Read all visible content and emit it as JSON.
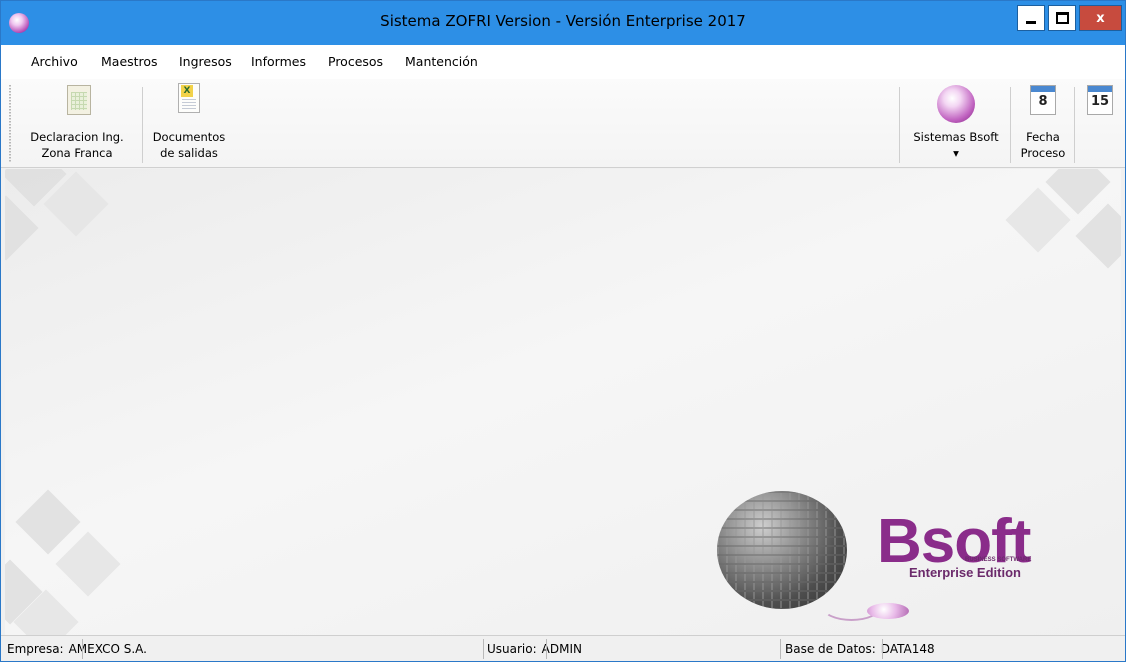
{
  "window": {
    "title": "Sistema ZOFRI Version  - Versión Enterprise 2017",
    "close_label": "x"
  },
  "menu": [
    "Archivo",
    "Maestros",
    "Ingresos",
    "Informes",
    "Procesos",
    "Mantención"
  ],
  "toolbar": {
    "declaracion": {
      "line1": "Declaracion Ing.",
      "line2": "Zona Franca"
    },
    "documentos": {
      "line1": "Documentos",
      "line2": "de salidas"
    },
    "sistemas": {
      "label": "Sistemas Bsoft",
      "arrow": "▾"
    },
    "fecha": {
      "line1": "Fecha",
      "line2": "Proceso"
    },
    "calendar_day_1": "8",
    "calendar_day_2": "15"
  },
  "logo": {
    "brand": "Bsoft",
    "sub": "BUSINESS SOFTWARE",
    "edition": "Enterprise Edition"
  },
  "statusbar": {
    "empresa_label": "Empresa:",
    "empresa_value": "AMEXCO S.A.",
    "usuario_label": "Usuario:",
    "usuario_value": "ADMIN",
    "base_label": "Base de Datos:",
    "base_value": "DATA148"
  },
  "colors": {
    "titlebar": "#2d8fe6",
    "close_button": "#c74b3e",
    "brand": "#8a2c8a"
  }
}
